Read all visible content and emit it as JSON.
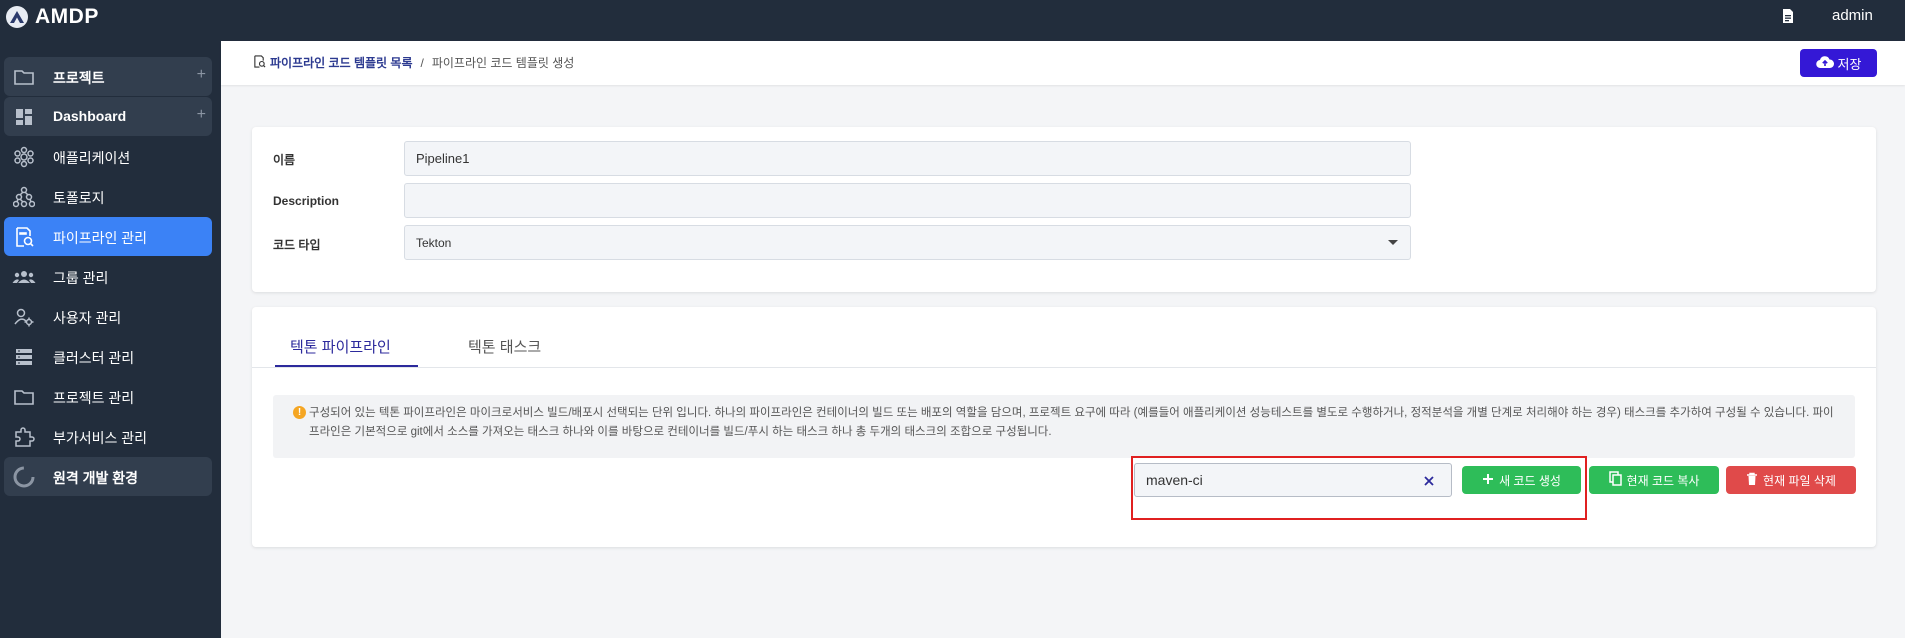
{
  "app": {
    "title": "AMDP",
    "user": "admin"
  },
  "sidebar": {
    "items": [
      {
        "label": "프로젝트",
        "icon": "folder-icon"
      },
      {
        "label": "Dashboard",
        "icon": "dashboard-icon"
      },
      {
        "label": "애플리케이션",
        "icon": "application-icon"
      },
      {
        "label": "토폴로지",
        "icon": "topology-icon"
      },
      {
        "label": "파이프라인 관리",
        "icon": "pipeline-icon"
      },
      {
        "label": "그룹 관리",
        "icon": "group-icon"
      },
      {
        "label": "사용자 관리",
        "icon": "user-settings-icon"
      },
      {
        "label": "클러스터 관리",
        "icon": "cluster-icon"
      },
      {
        "label": "프로젝트 관리",
        "icon": "folder-manage-icon"
      },
      {
        "label": "부가서비스 관리",
        "icon": "extension-icon"
      },
      {
        "label": "원격 개발 환경",
        "icon": "loading-ring-icon"
      }
    ],
    "plus_symbol": "+"
  },
  "breadcrumb": {
    "link": "파이프라인 코드 템플릿 목록",
    "separator": "/",
    "current": "파이프라인 코드 템플릿 생성"
  },
  "toolbar": {
    "save_label": "저장"
  },
  "form": {
    "name_label": "이름",
    "name_value": "Pipeline1",
    "description_label": "Description",
    "description_value": "",
    "code_type_label": "코드 타입",
    "code_type_value": "Tekton"
  },
  "tabs": [
    {
      "label": "텍톤 파이프라인",
      "active": true
    },
    {
      "label": "텍톤 태스크",
      "active": false
    }
  ],
  "info": {
    "icon_symbol": "!",
    "text": "구성되어 있는 텍톤 파이프라인은 마이크로서비스 빌드/배포시 선택되는 단위 입니다. 하나의 파이프라인은 컨테이너의 빌드 또는 배포의 역할을 담으며, 프로젝트 요구에 따라 (예를들어 애플리케이션 성능테스트를 별도로 수행하거나, 정적분석을 개별 단계로 처리해야 하는 경우) 태스크를 추가하여 구성될 수 있습니다. 파이프라인은 기본적으로 git에서 소스를 가져오는 태스크 하나와 이를 바탕으로 컨테이너를 빌드/푸시 하는 태스크 하나 총 두개의 태스크의 조합으로 구성됩니다."
  },
  "code": {
    "input_value": "maven-ci",
    "new_label": "새 코드 생성",
    "copy_label": "현재 코드 복사",
    "delete_label": "현재 파일 삭제"
  },
  "colors": {
    "sidebar_bg": "#222d3c",
    "active_item": "#3b82f6",
    "primary": "#3418d6",
    "success": "#2ebd59",
    "danger": "#e04a4a",
    "highlight_border": "#e02020"
  }
}
